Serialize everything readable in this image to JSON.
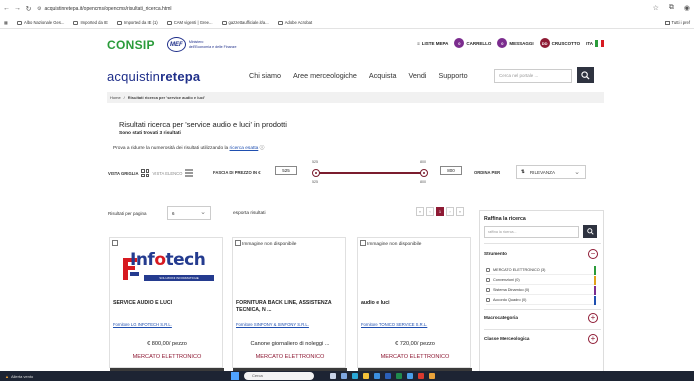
{
  "browser": {
    "url": "acquistinretepa.it/opencms/opencms/risultati_ricerca.html",
    "bookmarks": [
      "Albo Nazionale Ges...",
      "Imported da IE",
      "Imported da IE (1)",
      "CAM vigenti | Gree...",
      "gazzettaufficiale.it/a...",
      "Adobe Acrobat"
    ],
    "all_favorites": "Tutti i pref"
  },
  "header": {
    "consip_logo": "CONSIP",
    "mef_badge": "MEF",
    "mef_text_1": "Ministero",
    "mef_text_2": "dell'Economia e delle Finanze",
    "links": {
      "vetrina": "LISTE MEPA",
      "carrello": "CARRELLO",
      "messaggi": "MESSAGGI",
      "cruscotto": "CRUSCOTTO",
      "lang": "ITA"
    },
    "badges": {
      "carrello": "0",
      "messaggi": "0",
      "cruscotto": "DD"
    }
  },
  "nav": {
    "logo_a": "acquistin",
    "logo_b": "retepa",
    "items": [
      "Chi siamo",
      "Aree merceologiche",
      "Acquista",
      "Vendi",
      "Supporto"
    ],
    "search_placeholder": "Cerca nel portale ..."
  },
  "breadcrumb": {
    "home": "Home",
    "current": "Risultati ricerca per 'service audio e luci'"
  },
  "results": {
    "title": "Risultati ricerca per 'service audio e luci' in prodotti",
    "count": "Sono stati trovati 3 risultati",
    "hint_prefix": "Prova a ridurre la numerosità dei risultati utilizzando la",
    "hint_link": "ricerca esatta"
  },
  "filters": {
    "vista_griglia": "VISTA GRIGLIA",
    "vista_elenco": "VISTA ELENCO",
    "price_label": "FASCIA DI PREZZO IN €",
    "price_min": "525",
    "price_max": "800",
    "price_min_top": "525",
    "price_max_top": "800",
    "price_min_bottom": "525",
    "price_max_bottom": "800",
    "sort_label": "ORDINA PER",
    "sort_value": "RILEVANZA"
  },
  "pagination": {
    "per_page_label": "Risultati per pagina",
    "per_page_value": "6",
    "export": "esporta risultati",
    "pages": [
      "«",
      "‹",
      "1",
      "›",
      "»"
    ]
  },
  "sidebar": {
    "title": "Raffina la ricerca",
    "search_placeholder": "raffina la ricerca...",
    "strumento": "Strumento",
    "strumento_items": [
      {
        "label": "MERCATO ELETTRONICO (3)",
        "color": "#2a9b3a"
      },
      {
        "label": "Convenzioni (0)",
        "color": "#e0a11a"
      },
      {
        "label": "Sistema Dinamico (0)",
        "color": "#7b2c8e"
      },
      {
        "label": "Accordo Quadro (0)",
        "color": "#1f4fb0"
      }
    ],
    "macrocategoria": "Macrocategoria",
    "classe": "Classe Merceologica"
  },
  "products": [
    {
      "image_alt": "",
      "logo_name_a": "Inf",
      "logo_name_b": "o",
      "logo_name_c": "tech",
      "logo_tag": "SOLUZIONI INFORMATICHE",
      "title": "SERVICE AUDIO E LUCI",
      "supplier": "Fornitore LG INFOTECH S.R.L.",
      "price": "€ 800,00/ pezzo",
      "market": "MERCATO ELETTRONICO"
    },
    {
      "image_alt": "Immagine non disponibile",
      "title": "FORNITURA BACK LINE, ASSISTENZA TECNICA, N ...",
      "supplier": "Fornitore SINFONY & SINFONY S.R.L.",
      "price": "Canone giornaliero di noleggi ...",
      "market": "MERCATO ELETTRONICO"
    },
    {
      "image_alt": "Immagine non disponibile",
      "title": "audio e luci",
      "supplier": "Fornitore TONICO SERVICE S.R.L.",
      "price": "€ 720,00/ pezzo",
      "market": "MERCATO ELETTRONICO"
    }
  ],
  "taskbar": {
    "weather": "Allerta vento",
    "search": "Cerca"
  }
}
